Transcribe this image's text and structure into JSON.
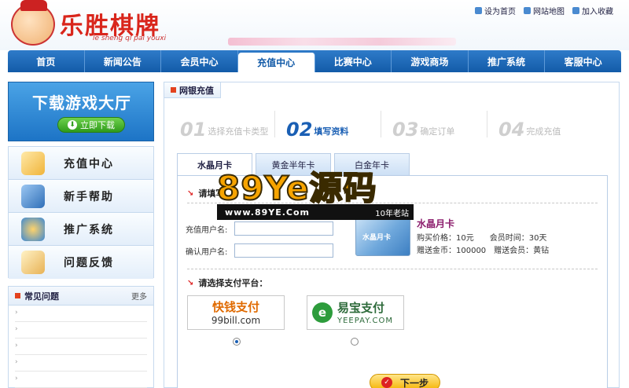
{
  "header": {
    "logo_text": "乐胜棋牌",
    "logo_pinyin": "le sheng qi pai youxi",
    "links": [
      "设为首页",
      "网站地图",
      "加入收藏"
    ]
  },
  "nav": {
    "items": [
      "首页",
      "新闻公告",
      "会员中心",
      "充值中心",
      "比赛中心",
      "游戏商场",
      "推广系统",
      "客服中心"
    ],
    "active_index": 3
  },
  "download": {
    "title": "下载游戏大厅",
    "button": "立即下载"
  },
  "side_menu": [
    "充值中心",
    "新手帮助",
    "推广系统",
    "问题反馈"
  ],
  "faq": {
    "title": "常见问题",
    "more": "更多"
  },
  "panel": {
    "tab": "网银充值",
    "steps": [
      {
        "num": "01",
        "label": "选择充值卡类型"
      },
      {
        "num": "02",
        "label": "填写资料"
      },
      {
        "num": "03",
        "label": "确定订单"
      },
      {
        "num": "04",
        "label": "完成充值"
      }
    ],
    "active_step": 1,
    "card_tabs": [
      "水晶月卡",
      "黄金半年卡",
      "白金年卡"
    ],
    "active_card_tab": 0,
    "section1": "请填写",
    "fields": [
      {
        "label": "充值用户名:",
        "value": ""
      },
      {
        "label": "确认用户名:",
        "value": ""
      }
    ],
    "card": {
      "image_label": "水晶月卡",
      "name": "水晶月卡",
      "line1": "购买价格：10元　　会员时间：30天",
      "line2": "赠送金币：100000　赠送会员：黄钻"
    },
    "section2": "请选择支付平台：",
    "payments": [
      {
        "name": "快钱支付",
        "sub": "99bill.com",
        "selected": true
      },
      {
        "name": "易宝支付",
        "sub": "YEEPAY.COM",
        "selected": false
      }
    ],
    "next_button": "下一步"
  },
  "watermark": {
    "big": "89Ye源码",
    "url": "www.89YE.Com",
    "tag": "10年老站"
  }
}
